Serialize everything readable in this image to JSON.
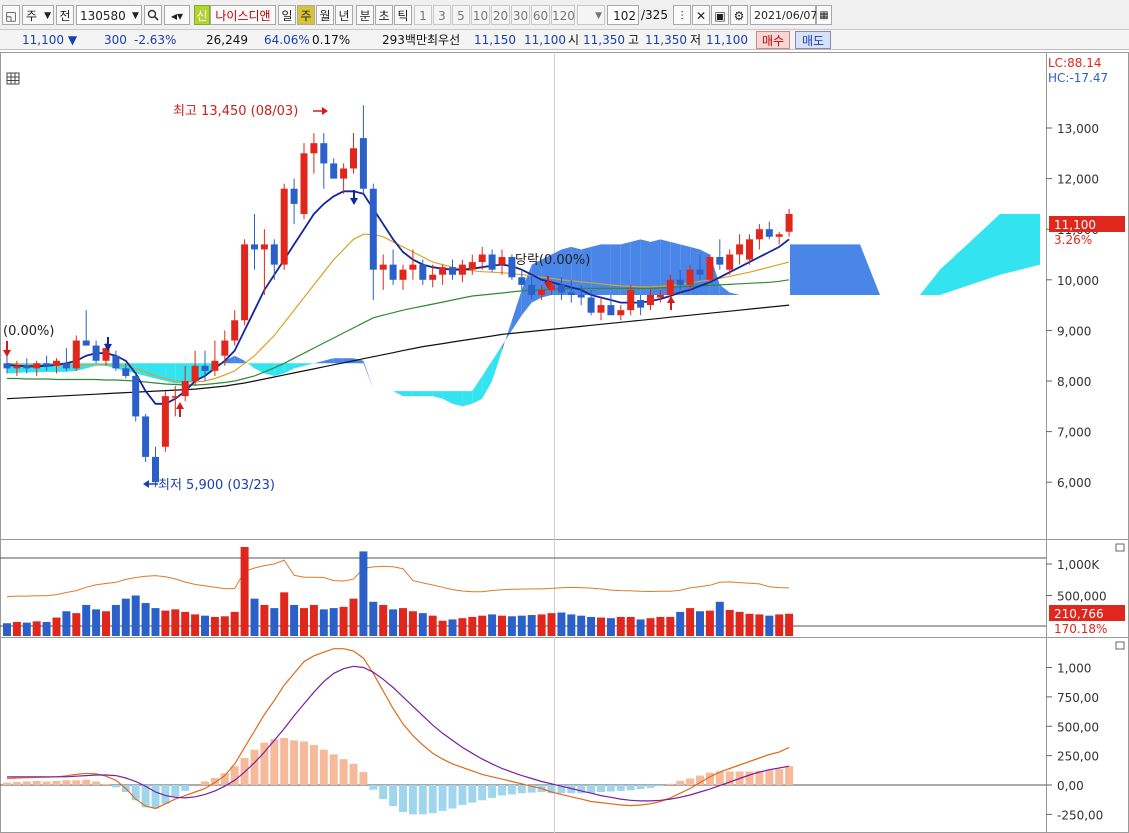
{
  "toolbar": {
    "market": "주",
    "prev": "전",
    "code": "130580",
    "new_badge": "신",
    "stock_name": "나이스디앤",
    "periods": [
      "일",
      "주",
      "월",
      "년",
      "분",
      "초",
      "틱"
    ],
    "active_period": "주",
    "intervals": [
      "1",
      "3",
      "5",
      "10",
      "20",
      "30",
      "60",
      "120"
    ],
    "count": "102",
    "total": "/325",
    "date": "2021/06/07"
  },
  "quote": {
    "price": "11,100",
    "change": "300",
    "change_pct": "-2.63%",
    "volume": "26,249",
    "ratio1": "64.06%",
    "ratio2": "0.17%",
    "amount": "293백만",
    "best_label": "최우선",
    "best_ask": "11,150",
    "best_bid": "11,100",
    "open_label": "시",
    "open": "11,350",
    "high_label": "고",
    "high": "11,350",
    "low_label": "저",
    "low": "11,100",
    "buy_label": "매수",
    "sell_label": "매도"
  },
  "chart": {
    "lc_label": "LC:88.14",
    "hc_label": "HC:-17.47",
    "price_ticks": [
      "13,000",
      "12,000",
      "11,000",
      "10,000",
      "9,000",
      "8,000",
      "7,000",
      "6,000"
    ],
    "current_price_tag": "11,100",
    "current_pct_tag": "3.26%",
    "high_annotation": "최고 13,450 (08/03)",
    "low_annotation": "최저 5,900 (03/23)",
    "left_annotation": "(0.00%)",
    "mid_annotation": "당락(0.00%)",
    "volume_ticks": [
      "1,000K",
      "500,000"
    ],
    "volume_tag": "210,766",
    "volume_pct_tag": "170.18%",
    "macd_ticks": [
      "1,000",
      "750,00",
      "500,00",
      "250,00",
      "0,00",
      "-250,00"
    ]
  },
  "colors": {
    "up": "#e0271d",
    "down": "#2b60c8",
    "cloud_pos": "#4a86e8",
    "cloud_neg": "#33e3f0",
    "ma5": "#13279a",
    "ma20": "#d8a424",
    "ma60": "#2f8a3a",
    "ma120": "#111111"
  },
  "chart_data": {
    "type": "candlestick",
    "xlabel": "",
    "ylabel": "",
    "ylim": [
      5400,
      14400
    ],
    "candles": [
      {
        "o": 8350,
        "h": 8500,
        "l": 8150,
        "c": 8250
      },
      {
        "o": 8250,
        "h": 8400,
        "l": 8100,
        "c": 8300
      },
      {
        "o": 8300,
        "h": 8450,
        "l": 8150,
        "c": 8250
      },
      {
        "o": 8250,
        "h": 8400,
        "l": 8100,
        "c": 8350
      },
      {
        "o": 8350,
        "h": 8500,
        "l": 8200,
        "c": 8300
      },
      {
        "o": 8300,
        "h": 8450,
        "l": 8150,
        "c": 8400
      },
      {
        "o": 8350,
        "h": 8650,
        "l": 8200,
        "c": 8250
      },
      {
        "o": 8250,
        "h": 8900,
        "l": 8200,
        "c": 8800
      },
      {
        "o": 8800,
        "h": 9400,
        "l": 8700,
        "c": 8700
      },
      {
        "o": 8700,
        "h": 8800,
        "l": 8350,
        "c": 8400
      },
      {
        "o": 8400,
        "h": 8750,
        "l": 8300,
        "c": 8650
      },
      {
        "o": 8500,
        "h": 8600,
        "l": 8200,
        "c": 8250
      },
      {
        "o": 8250,
        "h": 8350,
        "l": 8050,
        "c": 8100
      },
      {
        "o": 8100,
        "h": 8150,
        "l": 7200,
        "c": 7300
      },
      {
        "o": 7300,
        "h": 7350,
        "l": 6400,
        "c": 6500
      },
      {
        "o": 6500,
        "h": 6700,
        "l": 5900,
        "c": 6000
      },
      {
        "o": 6700,
        "h": 7800,
        "l": 6600,
        "c": 7700
      },
      {
        "o": 7700,
        "h": 7900,
        "l": 7300,
        "c": 7700
      },
      {
        "o": 7700,
        "h": 8300,
        "l": 7600,
        "c": 8000
      },
      {
        "o": 8000,
        "h": 8600,
        "l": 7900,
        "c": 8300
      },
      {
        "o": 8300,
        "h": 8600,
        "l": 8000,
        "c": 8200
      },
      {
        "o": 8200,
        "h": 8800,
        "l": 8100,
        "c": 8400
      },
      {
        "o": 8500,
        "h": 9000,
        "l": 8300,
        "c": 8800
      },
      {
        "o": 8800,
        "h": 9400,
        "l": 8700,
        "c": 9200
      },
      {
        "o": 9200,
        "h": 10800,
        "l": 9100,
        "c": 10700
      },
      {
        "o": 10700,
        "h": 11300,
        "l": 10200,
        "c": 10600
      },
      {
        "o": 10600,
        "h": 11000,
        "l": 9700,
        "c": 10700
      },
      {
        "o": 10700,
        "h": 10800,
        "l": 10000,
        "c": 10300
      },
      {
        "o": 10300,
        "h": 11900,
        "l": 10200,
        "c": 11800
      },
      {
        "o": 11800,
        "h": 12000,
        "l": 11100,
        "c": 11500
      },
      {
        "o": 11300,
        "h": 12700,
        "l": 11200,
        "c": 12500
      },
      {
        "o": 12500,
        "h": 12900,
        "l": 12100,
        "c": 12700
      },
      {
        "o": 12700,
        "h": 12900,
        "l": 11800,
        "c": 12300
      },
      {
        "o": 12300,
        "h": 12400,
        "l": 12000,
        "c": 12000
      },
      {
        "o": 12000,
        "h": 12300,
        "l": 11700,
        "c": 12200
      },
      {
        "o": 12200,
        "h": 12900,
        "l": 12100,
        "c": 12600
      },
      {
        "o": 12800,
        "h": 13450,
        "l": 11700,
        "c": 11800
      },
      {
        "o": 11800,
        "h": 11900,
        "l": 9600,
        "c": 10200
      },
      {
        "o": 10200,
        "h": 10500,
        "l": 9800,
        "c": 10300
      },
      {
        "o": 10300,
        "h": 10600,
        "l": 9900,
        "c": 10000
      },
      {
        "o": 10000,
        "h": 10300,
        "l": 9800,
        "c": 10200
      },
      {
        "o": 10200,
        "h": 10600,
        "l": 10000,
        "c": 10300
      },
      {
        "o": 10300,
        "h": 10400,
        "l": 9900,
        "c": 10000
      },
      {
        "o": 10000,
        "h": 10300,
        "l": 9850,
        "c": 10100
      },
      {
        "o": 10100,
        "h": 10300,
        "l": 9900,
        "c": 10250
      },
      {
        "o": 10250,
        "h": 10400,
        "l": 10000,
        "c": 10100
      },
      {
        "o": 10100,
        "h": 10400,
        "l": 9950,
        "c": 10300
      },
      {
        "o": 10200,
        "h": 10500,
        "l": 10100,
        "c": 10350
      },
      {
        "o": 10350,
        "h": 10650,
        "l": 10200,
        "c": 10500
      },
      {
        "o": 10500,
        "h": 10600,
        "l": 10150,
        "c": 10200
      },
      {
        "o": 10300,
        "h": 10600,
        "l": 10100,
        "c": 10450
      },
      {
        "o": 10450,
        "h": 10500,
        "l": 10000,
        "c": 10050
      },
      {
        "o": 10050,
        "h": 10200,
        "l": 9800,
        "c": 9900
      },
      {
        "o": 9900,
        "h": 10100,
        "l": 9600,
        "c": 9700
      },
      {
        "o": 9700,
        "h": 9900,
        "l": 9600,
        "c": 9800
      },
      {
        "o": 9800,
        "h": 10000,
        "l": 9700,
        "c": 9900
      },
      {
        "o": 9900,
        "h": 10050,
        "l": 9600,
        "c": 9750
      },
      {
        "o": 9750,
        "h": 10000,
        "l": 9550,
        "c": 9700
      },
      {
        "o": 9700,
        "h": 9900,
        "l": 9500,
        "c": 9650
      },
      {
        "o": 9650,
        "h": 9800,
        "l": 9300,
        "c": 9350
      },
      {
        "o": 9350,
        "h": 9650,
        "l": 9200,
        "c": 9500
      },
      {
        "o": 9500,
        "h": 9700,
        "l": 9300,
        "c": 9300
      },
      {
        "o": 9300,
        "h": 9500,
        "l": 9200,
        "c": 9400
      },
      {
        "o": 9400,
        "h": 9900,
        "l": 9300,
        "c": 9800
      },
      {
        "o": 9600,
        "h": 9700,
        "l": 9300,
        "c": 9450
      },
      {
        "o": 9500,
        "h": 9850,
        "l": 9400,
        "c": 9700
      },
      {
        "o": 9650,
        "h": 9800,
        "l": 9550,
        "c": 9700
      },
      {
        "o": 9700,
        "h": 10100,
        "l": 9650,
        "c": 10000
      },
      {
        "o": 10000,
        "h": 10200,
        "l": 9800,
        "c": 9900
      },
      {
        "o": 9900,
        "h": 10300,
        "l": 9800,
        "c": 10200
      },
      {
        "o": 10200,
        "h": 10500,
        "l": 10000,
        "c": 10100
      },
      {
        "o": 10000,
        "h": 10500,
        "l": 9950,
        "c": 10450
      },
      {
        "o": 10450,
        "h": 10800,
        "l": 10200,
        "c": 10300
      },
      {
        "o": 10200,
        "h": 10600,
        "l": 10100,
        "c": 10500
      },
      {
        "o": 10500,
        "h": 10900,
        "l": 10300,
        "c": 10700
      },
      {
        "o": 10400,
        "h": 10900,
        "l": 10300,
        "c": 10800
      },
      {
        "o": 10800,
        "h": 11100,
        "l": 10600,
        "c": 11000
      },
      {
        "o": 11000,
        "h": 11150,
        "l": 10800,
        "c": 10850
      },
      {
        "o": 10850,
        "h": 10950,
        "l": 10700,
        "c": 10900
      },
      {
        "o": 10950,
        "h": 11400,
        "l": 10850,
        "c": 11300
      }
    ],
    "ma5": [
      8320,
      8300,
      8290,
      8290,
      8300,
      8320,
      8350,
      8400,
      8500,
      8550,
      8550,
      8500,
      8400,
      8150,
      7800,
      7550,
      7550,
      7650,
      7800,
      8000,
      8100,
      8250,
      8400,
      8600,
      9000,
      9400,
      9800,
      10100,
      10400,
      10700,
      11000,
      11300,
      11500,
      11650,
      11750,
      11750,
      11700,
      11400,
      11100,
      10800,
      10550,
      10400,
      10300,
      10250,
      10220,
      10200,
      10200,
      10220,
      10250,
      10280,
      10300,
      10270,
      10200,
      10100,
      10000,
      9950,
      9900,
      9850,
      9800,
      9700,
      9650,
      9600,
      9550,
      9550,
      9550,
      9580,
      9620,
      9680,
      9750,
      9800,
      9880,
      9950,
      10050,
      10150,
      10250,
      10350,
      10450,
      10550,
      10650,
      10800
    ],
    "ma20": [
      8350,
      8340,
      8330,
      8320,
      8310,
      8300,
      8300,
      8310,
      8320,
      8330,
      8330,
      8320,
      8300,
      8250,
      8180,
      8100,
      8050,
      8000,
      7980,
      7980,
      8000,
      8050,
      8120,
      8200,
      8350,
      8500,
      8700,
      8900,
      9150,
      9400,
      9650,
      9900,
      10150,
      10400,
      10600,
      10800,
      10900,
      10900,
      10850,
      10750,
      10650,
      10550,
      10450,
      10350,
      10300,
      10250,
      10200,
      10180,
      10160,
      10150,
      10140,
      10120,
      10100,
      10080,
      10050,
      10030,
      10000,
      9980,
      9960,
      9940,
      9920,
      9900,
      9880,
      9870,
      9860,
      9860,
      9870,
      9890,
      9910,
      9940,
      9970,
      10000,
      10030,
      10070,
      10110,
      10150,
      10200,
      10250,
      10300,
      10350
    ],
    "ma60": [
      8050,
      8050,
      8040,
      8040,
      8040,
      8030,
      8030,
      8030,
      8030,
      8030,
      8020,
      8020,
      8010,
      8000,
      7980,
      7960,
      7940,
      7930,
      7920,
      7920,
      7930,
      7950,
      7970,
      8000,
      8050,
      8100,
      8180,
      8260,
      8350,
      8450,
      8550,
      8650,
      8750,
      8850,
      8950,
      9050,
      9150,
      9250,
      9300,
      9350,
      9400,
      9440,
      9480,
      9520,
      9560,
      9600,
      9640,
      9680,
      9700,
      9720,
      9740,
      9760,
      9780,
      9790,
      9800,
      9810,
      9820,
      9830,
      9830,
      9830,
      9830,
      9830,
      9830,
      9830,
      9830,
      9830,
      9840,
      9850,
      9860,
      9870,
      9880,
      9890,
      9900,
      9910,
      9920,
      9930,
      9940,
      9950,
      9970,
      10000
    ],
    "ma120": [
      7650,
      7660,
      7670,
      7680,
      7690,
      7700,
      7710,
      7720,
      7730,
      7740,
      7750,
      7760,
      7770,
      7780,
      7790,
      7800,
      7810,
      7820,
      7830,
      7840,
      7860,
      7880,
      7900,
      7930,
      7960,
      8000,
      8040,
      8080,
      8120,
      8160,
      8200,
      8240,
      8280,
      8320,
      8360,
      8400,
      8440,
      8480,
      8520,
      8560,
      8600,
      8640,
      8680,
      8710,
      8740,
      8770,
      8800,
      8830,
      8860,
      8890,
      8920,
      8940,
      8960,
      8980,
      9000,
      9020,
      9040,
      9060,
      9080,
      9100,
      9120,
      9140,
      9160,
      9180,
      9200,
      9220,
      9240,
      9260,
      9280,
      9300,
      9320,
      9340,
      9360,
      9380,
      9400,
      9420,
      9440,
      9460,
      9480,
      9500
    ],
    "cloud_span_a": [
      8150,
      8160,
      8170,
      8170,
      8180,
      8180,
      8180,
      8200,
      8250,
      8300,
      8300,
      8250,
      8200,
      8150,
      8100,
      8050,
      8000,
      7950,
      7950,
      8000,
      8100,
      8250,
      8400,
      8500,
      8400,
      8250,
      8150,
      8100,
      8150,
      8250,
      8300,
      8350,
      8400,
      8450,
      8450,
      8450,
      8400,
      7850,
      7850,
      7800,
      7700,
      7700,
      7700,
      7700,
      7650,
      7550,
      7500,
      7550,
      7650,
      8000,
      8600,
      9200,
      9800,
      10300,
      10400,
      10500,
      10600,
      10650,
      10600,
      10650,
      10700,
      10700,
      10700,
      10750,
      10800,
      10750,
      10800,
      10750,
      10700,
      10650,
      10600,
      10500,
      9900,
      9750,
      9700,
      9700,
      9700,
      9700,
      9700,
      9700
    ],
    "cloud_span_b": [
      8350,
      8350,
      8350,
      8350,
      8350,
      8350,
      8350,
      8350,
      8350,
      8350,
      8350,
      8350,
      8350,
      8350,
      8350,
      8350,
      8350,
      8350,
      8350,
      8350,
      8350,
      8350,
      8350,
      8350,
      8350,
      8350,
      8350,
      8350,
      8350,
      8350,
      8350,
      8350,
      8350,
      8350,
      8350,
      8350,
      8350,
      7850,
      7850,
      7800,
      7800,
      7800,
      7800,
      7800,
      7800,
      7800,
      7800,
      7800,
      8100,
      8400,
      8700,
      9000,
      9300,
      9550,
      9650,
      9700,
      9700,
      9700,
      9700,
      9700,
      9700,
      9700,
      9700,
      9700,
      9700,
      9700,
      9700,
      9700,
      9700,
      9700,
      9700,
      9700,
      9700,
      9700,
      9700,
      9700,
      9700,
      9700,
      9700,
      9700
    ],
    "volume": [
      60000,
      80000,
      70000,
      90000,
      80000,
      150000,
      250000,
      220000,
      350000,
      280000,
      250000,
      350000,
      450000,
      500000,
      380000,
      300000,
      260000,
      280000,
      240000,
      200000,
      180000,
      160000,
      170000,
      240000,
      1560000,
      450000,
      350000,
      300000,
      550000,
      350000,
      300000,
      350000,
      280000,
      300000,
      320000,
      450000,
      1200000,
      400000,
      350000,
      280000,
      300000,
      250000,
      220000,
      180000,
      100000,
      120000,
      140000,
      160000,
      180000,
      200000,
      180000,
      170000,
      180000,
      190000,
      200000,
      220000,
      230000,
      200000,
      180000,
      160000,
      150000,
      140000,
      160000,
      160000,
      120000,
      140000,
      160000,
      160000,
      240000,
      300000,
      250000,
      260000,
      400000,
      270000,
      240000,
      210000,
      200000,
      180000,
      200000,
      210766
    ],
    "macd": [
      55,
      60,
      62,
      65,
      66,
      70,
      78,
      90,
      100,
      95,
      75,
      40,
      -30,
      -120,
      -180,
      -200,
      -160,
      -120,
      -90,
      -60,
      -30,
      20,
      80,
      180,
      320,
      460,
      600,
      720,
      850,
      950,
      1050,
      1100,
      1130,
      1160,
      1160,
      1140,
      1080,
      950,
      800,
      650,
      520,
      420,
      340,
      270,
      220,
      180,
      150,
      120,
      90,
      70,
      50,
      30,
      10,
      -10,
      -30,
      -60,
      -80,
      -100,
      -120,
      -140,
      -150,
      -160,
      -170,
      -175,
      -170,
      -160,
      -140,
      -110,
      -70,
      -30,
      20,
      70,
      110,
      140,
      170,
      200,
      230,
      260,
      280,
      320
    ],
    "signal": [
      70,
      70,
      70,
      70,
      70,
      70,
      70,
      75,
      80,
      85,
      85,
      80,
      60,
      30,
      -10,
      -60,
      -90,
      -105,
      -110,
      -100,
      -80,
      -50,
      -10,
      40,
      110,
      190,
      280,
      380,
      480,
      590,
      690,
      790,
      880,
      950,
      990,
      1010,
      1000,
      960,
      900,
      830,
      750,
      670,
      590,
      510,
      440,
      380,
      320,
      270,
      220,
      180,
      140,
      110,
      80,
      55,
      30,
      10,
      -10,
      -30,
      -50,
      -70,
      -90,
      -105,
      -120,
      -130,
      -135,
      -135,
      -130,
      -120,
      -105,
      -85,
      -60,
      -35,
      -5,
      25,
      55,
      85,
      110,
      130,
      145,
      160
    ],
    "osc": [
      20,
      25,
      30,
      35,
      30,
      35,
      40,
      40,
      45,
      30,
      10,
      -20,
      -60,
      -130,
      -190,
      -200,
      -160,
      -100,
      -50,
      0,
      30,
      60,
      100,
      160,
      230,
      300,
      360,
      390,
      400,
      380,
      370,
      340,
      300,
      260,
      220,
      180,
      110,
      -40,
      -120,
      -180,
      -230,
      -250,
      -250,
      -240,
      -220,
      -200,
      -170,
      -150,
      -130,
      -110,
      -90,
      -80,
      -70,
      -65,
      -60,
      -70,
      -70,
      -70,
      -70,
      -70,
      -60,
      -55,
      -50,
      -45,
      -35,
      -25,
      -10,
      10,
      35,
      55,
      80,
      105,
      115,
      115,
      115,
      115,
      120,
      130,
      135,
      160
    ]
  }
}
